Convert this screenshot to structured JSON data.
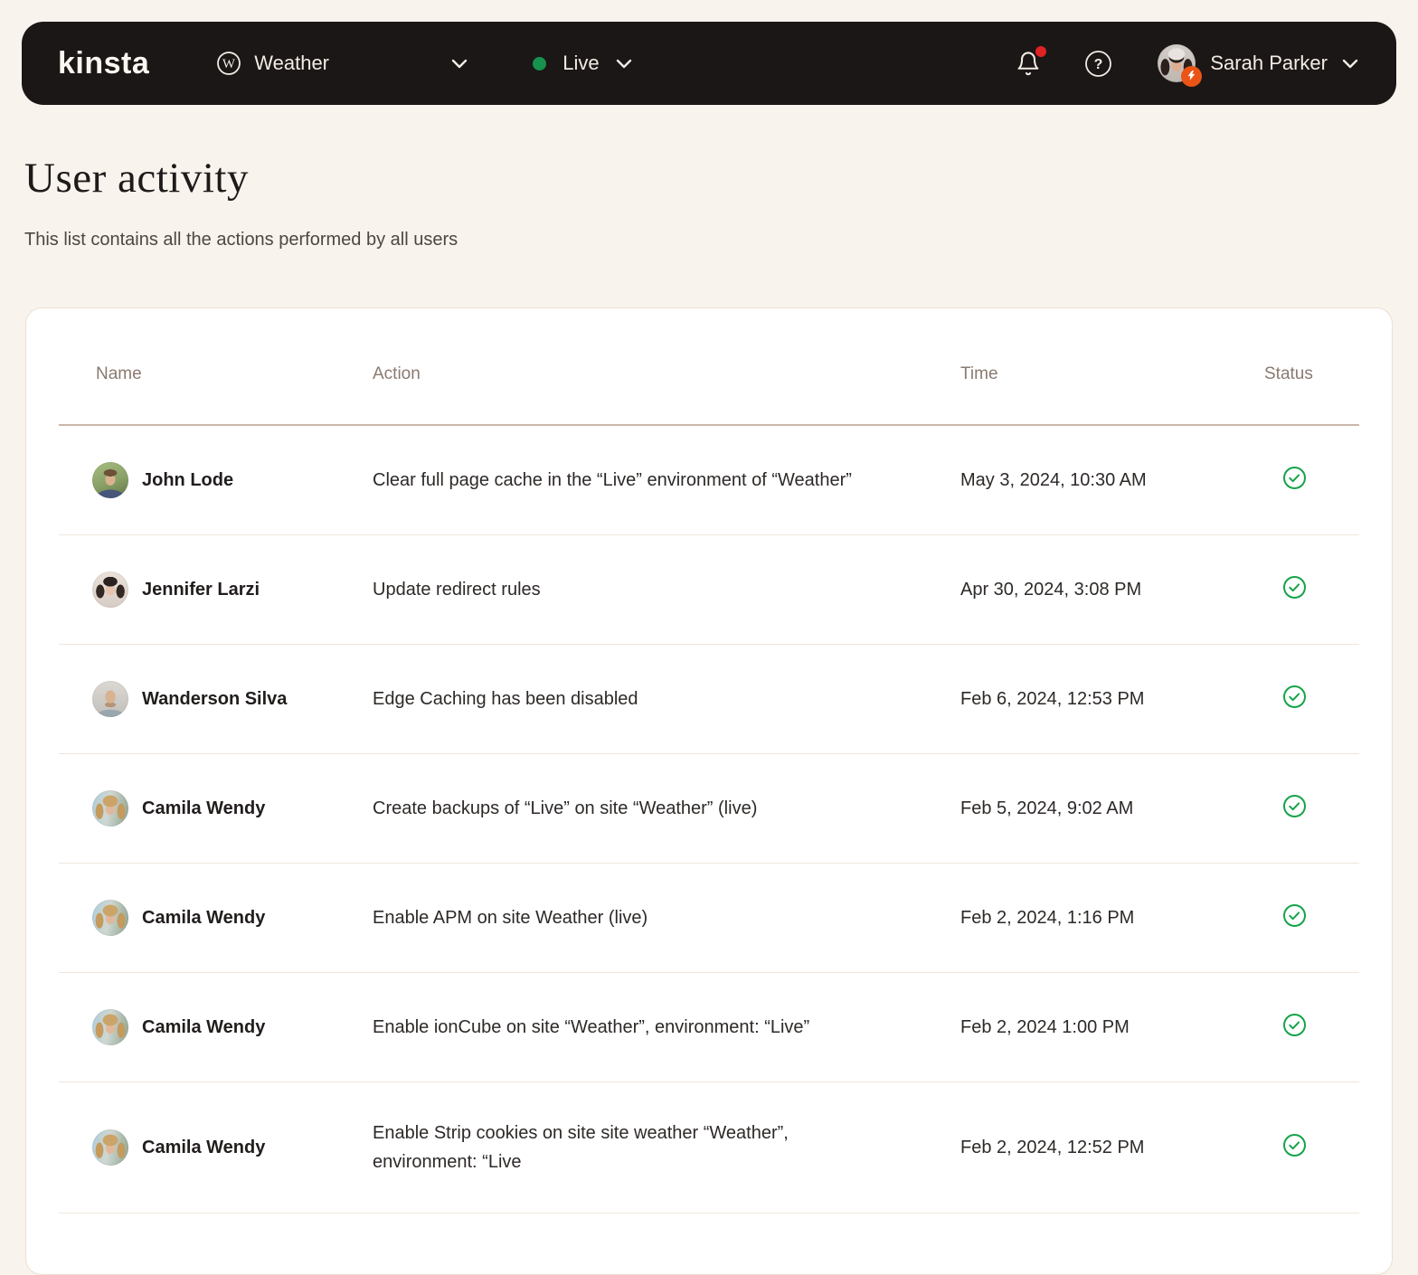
{
  "navbar": {
    "logo": "kinsta",
    "site_selector": {
      "label": "Weather",
      "icon": "wordpress-icon"
    },
    "env_selector": {
      "label": "Live",
      "status_dot_color": "#17914e"
    },
    "notifications": {
      "icon": "bell-icon",
      "unread_dot_color": "#e02222"
    },
    "help": {
      "icon": "question-circle-icon",
      "glyph": "?"
    },
    "user": {
      "name": "Sarah Parker",
      "avatar": "sarah-parker",
      "badge_icon": "lightning-bolt-icon",
      "badge_color": "#ea5517"
    }
  },
  "page": {
    "title": "User activity",
    "subtitle": "This list contains all the actions performed by all users"
  },
  "table": {
    "columns": [
      "Name",
      "Action",
      "Time",
      "Status"
    ],
    "status_icon": "check-circle-icon",
    "rows": [
      {
        "name": "John Lode",
        "avatar": "john-lode",
        "action": "Clear full page cache in the “Live” environment of “Weather”",
        "time": "May 3, 2024, 10:30 AM",
        "status": "success"
      },
      {
        "name": "Jennifer Larzi",
        "avatar": "jennifer-larzi",
        "action": "Update redirect rules",
        "time": "Apr 30, 2024, 3:08 PM",
        "status": "success"
      },
      {
        "name": "Wanderson Silva",
        "avatar": "wanderson-silva",
        "action": "Edge Caching has been disabled",
        "time": "Feb 6, 2024, 12:53 PM",
        "status": "success"
      },
      {
        "name": "Camila Wendy",
        "avatar": "camila-wendy",
        "action": "Create backups of “Live” on site “Weather” (live)",
        "time": "Feb 5, 2024, 9:02 AM",
        "status": "success"
      },
      {
        "name": "Camila Wendy",
        "avatar": "camila-wendy",
        "action": "Enable APM on site Weather (live)",
        "time": "Feb 2, 2024, 1:16 PM",
        "status": "success"
      },
      {
        "name": "Camila Wendy",
        "avatar": "camila-wendy",
        "action": "Enable ionCube on site “Weather”, environment: “Live”",
        "time": "Feb 2, 2024 1:00 PM",
        "status": "success"
      },
      {
        "name": "Camila Wendy",
        "avatar": "camila-wendy",
        "action": "Enable Strip cookies on site site weather “Weather”, environment: “Live",
        "time": "Feb 2, 2024, 12:52 PM",
        "status": "success"
      }
    ]
  },
  "colors": {
    "page_background": "#f8f3ed",
    "navbar_background": "#1b1716",
    "card_background": "#ffffff",
    "card_border": "#ecdfd1",
    "success_green": "#16a34a",
    "env_dot_green": "#17914e",
    "notification_red": "#e02222",
    "badge_orange": "#ea5517"
  }
}
